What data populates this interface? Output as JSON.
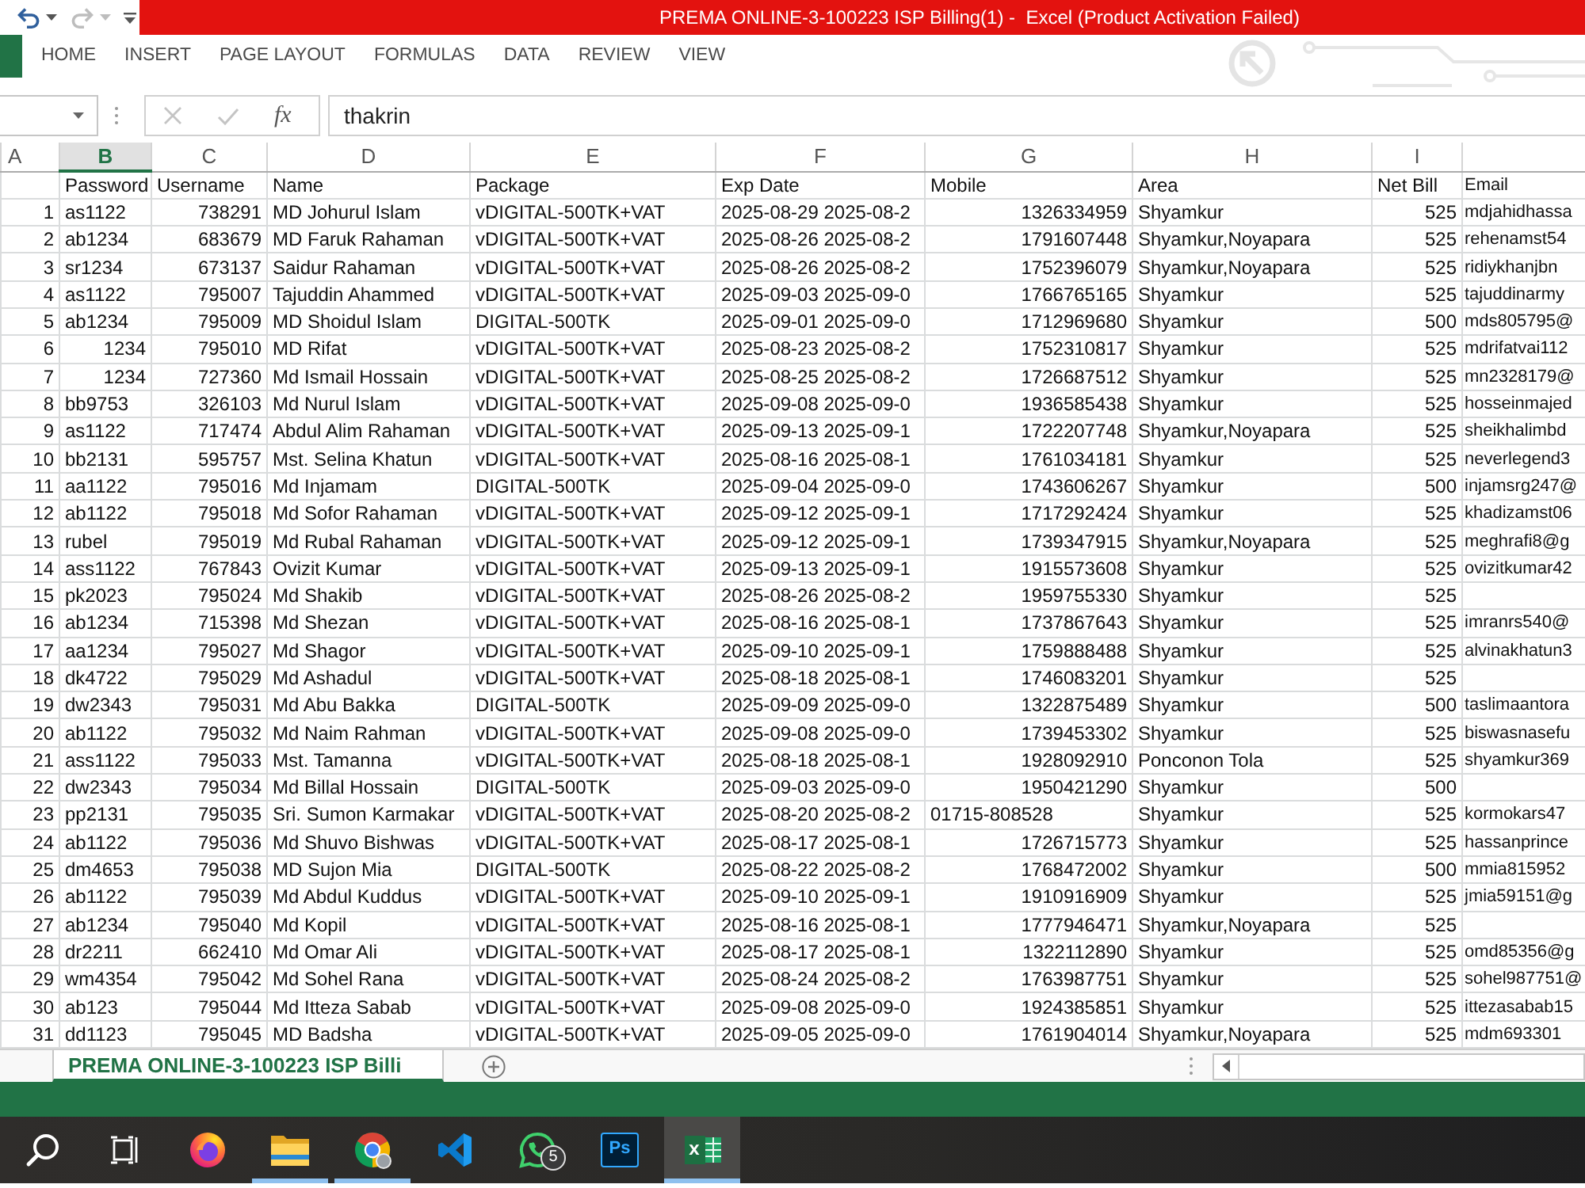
{
  "title_bar": {
    "quick_access": [
      {
        "kind": "undo",
        "disabled": false
      },
      {
        "kind": "menu",
        "disabled": false
      },
      {
        "kind": "redo",
        "disabled": true
      },
      {
        "kind": "menu",
        "disabled": true
      },
      {
        "kind": "customize",
        "disabled": false
      }
    ],
    "title": "PREMA ONLINE-3-100223 ISP Billing(1) -  Excel (Product Activation Failed)"
  },
  "ribbon": {
    "tabs": [
      "HOME",
      "INSERT",
      "PAGE LAYOUT",
      "FORMULAS",
      "DATA",
      "REVIEW",
      "VIEW"
    ]
  },
  "formula_bar": {
    "buttons": [
      {
        "kind": "cancel",
        "disabled": true
      },
      {
        "kind": "enter",
        "disabled": true
      },
      {
        "kind": "function",
        "label": "fx",
        "disabled": false
      }
    ],
    "value": "thakrin"
  },
  "sheet": {
    "columns": [
      {
        "letter": "A",
        "kind": "number",
        "selected": false
      },
      {
        "letter": "B",
        "kind": "text",
        "selected": true
      },
      {
        "letter": "C",
        "kind": "number",
        "selected": false
      },
      {
        "letter": "D",
        "kind": "text",
        "selected": false
      },
      {
        "letter": "E",
        "kind": "text",
        "selected": false
      },
      {
        "letter": "F",
        "kind": "text",
        "selected": false
      },
      {
        "letter": "G",
        "kind": "number",
        "selected": false
      },
      {
        "letter": "H",
        "kind": "text",
        "selected": false
      },
      {
        "letter": "I",
        "kind": "number",
        "selected": false
      },
      {
        "kind": "text",
        "selected": false
      }
    ],
    "header_cells": [
      null,
      "Password",
      "Username",
      "Name",
      "Package",
      "Exp Date",
      "Mobile",
      "Area",
      "Net Bill",
      "Email"
    ],
    "rows": [
      [
        "1",
        "as1122",
        "738291",
        "MD Johurul Islam",
        "vDIGITAL-500TK+VAT",
        "2025-08-29 2025-08-2",
        "1326334959",
        "Shyamkur",
        "525",
        "mdjahidhassa"
      ],
      [
        "2",
        "ab1234",
        "683679",
        "MD Faruk Rahaman",
        "vDIGITAL-500TK+VAT",
        "2025-08-26 2025-08-2",
        "1791607448",
        "Shyamkur,Noyapara",
        "525",
        "rehenamst54"
      ],
      [
        "3",
        "sr1234",
        "673137",
        "Saidur Rahaman",
        "vDIGITAL-500TK+VAT",
        "2025-08-26 2025-08-2",
        "1752396079",
        "Shyamkur,Noyapara",
        "525",
        "ridiykhanjbn"
      ],
      [
        "4",
        "as1122",
        "795007",
        "Tajuddin Ahammed",
        "vDIGITAL-500TK+VAT",
        "2025-09-03 2025-09-0",
        "1766765165",
        "Shyamkur",
        "525",
        "tajuddinarmy"
      ],
      [
        "5",
        "ab1234",
        "795009",
        "MD Shoidul Islam",
        "DIGITAL-500TK",
        "2025-09-01 2025-09-0",
        "1712969680",
        "Shyamkur",
        "500",
        "mds805795@"
      ],
      [
        "6",
        {
          "text": "1234",
          "kind": "number"
        },
        "795010",
        "MD Rifat",
        "vDIGITAL-500TK+VAT",
        "2025-08-23 2025-08-2",
        "1752310817",
        "Shyamkur",
        "525",
        "mdrifatvai112"
      ],
      [
        "7",
        {
          "text": "1234",
          "kind": "number"
        },
        "727360",
        "Md Ismail Hossain",
        "vDIGITAL-500TK+VAT",
        "2025-08-25 2025-08-2",
        "1726687512",
        "Shyamkur",
        "525",
        "mn2328179@"
      ],
      [
        "8",
        "bb9753",
        "326103",
        "Md Nurul Islam",
        "vDIGITAL-500TK+VAT",
        "2025-09-08 2025-09-0",
        "1936585438",
        "Shyamkur",
        "525",
        "hosseinmajed"
      ],
      [
        "9",
        "as1122",
        "717474",
        "Abdul Alim Rahaman",
        "vDIGITAL-500TK+VAT",
        "2025-09-13 2025-09-1",
        "1722207748",
        "Shyamkur,Noyapara",
        "525",
        "sheikhalimbd"
      ],
      [
        "10",
        "bb2131",
        "595757",
        "Mst. Selina Khatun",
        "vDIGITAL-500TK+VAT",
        "2025-08-16 2025-08-1",
        "1761034181",
        "Shyamkur",
        "525",
        "neverlegend3"
      ],
      [
        "11",
        "aa1122",
        "795016",
        "Md Injamam",
        "DIGITAL-500TK",
        "2025-09-04 2025-09-0",
        "1743606267",
        "Shyamkur",
        "500",
        "injamsrg247@"
      ],
      [
        "12",
        "ab1122",
        "795018",
        "Md Sofor Rahaman",
        "vDIGITAL-500TK+VAT",
        "2025-09-12 2025-09-1",
        "1717292424",
        "Shyamkur",
        "525",
        "khadizamst06"
      ],
      [
        "13",
        "rubel",
        "795019",
        "Md Rubal Rahaman",
        "vDIGITAL-500TK+VAT",
        "2025-09-12 2025-09-1",
        "1739347915",
        "Shyamkur,Noyapara",
        "525",
        "meghrafi8@g"
      ],
      [
        "14",
        "ass1122",
        "767843",
        "Ovizit Kumar",
        "vDIGITAL-500TK+VAT",
        "2025-09-13 2025-09-1",
        "1915573608",
        "Shyamkur",
        "525",
        "ovizitkumar42"
      ],
      [
        "15",
        "pk2023",
        "795024",
        "Md Shakib",
        "vDIGITAL-500TK+VAT",
        "2025-08-26 2025-08-2",
        "1959755330",
        "Shyamkur",
        "525",
        null
      ],
      [
        "16",
        "ab1234",
        "715398",
        "Md Shezan",
        "vDIGITAL-500TK+VAT",
        "2025-08-16 2025-08-1",
        "1737867643",
        "Shyamkur",
        "525",
        "imranrs540@"
      ],
      [
        "17",
        "aa1234",
        "795027",
        "Md Shagor",
        "vDIGITAL-500TK+VAT",
        "2025-09-10 2025-09-1",
        "1759888488",
        "Shyamkur",
        "525",
        "alvinakhatun3"
      ],
      [
        "18",
        "dk4722",
        "795029",
        "Md Ashadul",
        "vDIGITAL-500TK+VAT",
        "2025-08-18 2025-08-1",
        "1746083201",
        "Shyamkur",
        "525",
        null
      ],
      [
        "19",
        "dw2343",
        "795031",
        "Md Abu Bakka",
        "DIGITAL-500TK",
        "2025-09-09 2025-09-0",
        "1322875489",
        "Shyamkur",
        "500",
        "taslimaantora"
      ],
      [
        "20",
        "ab1122",
        "795032",
        "Md Naim Rahman",
        "vDIGITAL-500TK+VAT",
        "2025-09-08 2025-09-0",
        "1739453302",
        "Shyamkur",
        "525",
        "biswasnasefu"
      ],
      [
        "21",
        "ass1122",
        "795033",
        "Mst. Tamanna",
        "vDIGITAL-500TK+VAT",
        "2025-08-18 2025-08-1",
        "1928092910",
        "Ponconon Tola",
        "525",
        "shyamkur369"
      ],
      [
        "22",
        "dw2343",
        "795034",
        "Md Billal Hossain",
        "DIGITAL-500TK",
        "2025-09-03 2025-09-0",
        "1950421290",
        "Shyamkur",
        "500",
        null
      ],
      [
        "23",
        "pp2131",
        "795035",
        "Sri. Sumon Karmakar",
        "vDIGITAL-500TK+VAT",
        "2025-08-20 2025-08-2",
        {
          "text": "01715-808528",
          "kind": "text"
        },
        "Shyamkur",
        "525",
        "kormokars47"
      ],
      [
        "24",
        "ab1122",
        "795036",
        "Md Shuvo Bishwas",
        "vDIGITAL-500TK+VAT",
        "2025-08-17 2025-08-1",
        "1726715773",
        "Shyamkur",
        "525",
        "hassanprince"
      ],
      [
        "25",
        "dm4653",
        "795038",
        "MD Sujon Mia",
        "DIGITAL-500TK",
        "2025-08-22 2025-08-2",
        "1768472002",
        "Shyamkur",
        "500",
        "mmia815952"
      ],
      [
        "26",
        "ab1122",
        "795039",
        "Md Abdul Kuddus",
        "vDIGITAL-500TK+VAT",
        "2025-09-10 2025-09-1",
        "1910916909",
        "Shyamkur",
        "525",
        "jmia59151@g"
      ],
      [
        "27",
        "ab1234",
        "795040",
        "Md Kopil",
        "vDIGITAL-500TK+VAT",
        "2025-08-16 2025-08-1",
        "1777946471",
        "Shyamkur,Noyapara",
        "525",
        null
      ],
      [
        "28",
        "dr2211",
        "662410",
        "Md Omar Ali",
        "vDIGITAL-500TK+VAT",
        "2025-08-17 2025-08-1",
        "1322112890",
        "Shyamkur",
        "525",
        "omd85356@g"
      ],
      [
        "29",
        "wm4354",
        "795042",
        "Md Sohel Rana",
        "vDIGITAL-500TK+VAT",
        "2025-08-24 2025-08-2",
        "1763987751",
        "Shyamkur",
        "525",
        "sohel987751@"
      ],
      [
        "30",
        "ab123",
        "795044",
        "Md Itteza Sabab",
        "vDIGITAL-500TK+VAT",
        "2025-09-08 2025-09-0",
        "1924385851",
        "Shyamkur",
        "525",
        "ittezasabab15"
      ],
      [
        "31",
        "dd1123",
        "795045",
        "MD Badsha",
        "vDIGITAL-500TK+VAT",
        "2025-09-05 2025-09-0",
        "1761904014",
        "Shyamkur,Noyapara",
        "525",
        "mdm693301"
      ]
    ]
  },
  "sheet_tabs": [
    {
      "label": "PREMA ONLINE-3-100223 ISP Billi",
      "selected": true
    }
  ],
  "taskbar": {
    "items": [
      {
        "kind": "search",
        "running": false,
        "active": false
      },
      {
        "kind": "task-view",
        "running": false,
        "active": false
      },
      {
        "kind": "firefox",
        "running": false,
        "active": false
      },
      {
        "kind": "folder",
        "running": true,
        "active": false
      },
      {
        "kind": "chrome",
        "running": true,
        "active": false
      },
      {
        "kind": "code",
        "running": false,
        "active": false
      },
      {
        "kind": "chat",
        "running": false,
        "active": false,
        "badge": "5"
      },
      {
        "kind": "ps",
        "label": "Ps",
        "running": false,
        "active": false
      },
      {
        "kind": "sheets",
        "label": "x",
        "running": true,
        "active": true
      }
    ]
  }
}
